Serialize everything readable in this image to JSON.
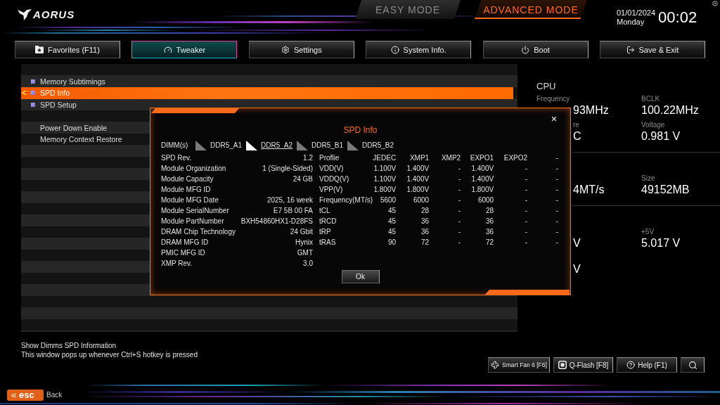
{
  "header": {
    "logo": "AORUS",
    "modes": [
      {
        "label": "EASY MODE",
        "selected": false
      },
      {
        "label": "ADVANCED MODE",
        "selected": true
      }
    ],
    "date": "01/01/2024",
    "day": "Monday",
    "time": "00:02"
  },
  "nav_tabs": [
    {
      "label": "Favorites (F11)",
      "selected": false
    },
    {
      "label": "Tweaker",
      "selected": true
    },
    {
      "label": "Settings",
      "selected": false
    },
    {
      "label": "System Info.",
      "selected": false
    },
    {
      "label": "Boot",
      "selected": false
    },
    {
      "label": "Save & Exit",
      "selected": false
    }
  ],
  "menu": {
    "groups": [
      {
        "items": [
          {
            "kind": "submenu",
            "label": "Memory Subtimings",
            "selected": false
          },
          {
            "kind": "submenu",
            "label": "SPD Info",
            "selected": true
          },
          {
            "kind": "submenu",
            "label": "SPD Setup",
            "selected": false
          }
        ]
      },
      {
        "items": [
          {
            "kind": "setting",
            "label": "Power Down Enable",
            "selected": false
          },
          {
            "kind": "setting",
            "label": "Memory Context Restore",
            "selected": false
          }
        ]
      }
    ]
  },
  "status_panel": {
    "title": "CPU",
    "groups": [
      {
        "rows": [
          {
            "cells": [
              {
                "label": "Frequency",
                "value": "93MHz"
              },
              {
                "label": "BCLK",
                "value": "100.22MHz"
              }
            ]
          },
          {
            "cells": [
              {
                "label": "re",
                "value": "C"
              },
              {
                "label": "Voltage",
                "value": "0.981 V"
              }
            ]
          }
        ]
      },
      {
        "rows": [
          {
            "cells": [
              {
                "value": "4MT/s"
              },
              {
                "label": "Size",
                "value": "49152MB"
              }
            ]
          }
        ]
      },
      {
        "rows": [
          {
            "cells": [
              {
                "value": "V"
              },
              {
                "label": "+5V",
                "value": "5.017 V"
              }
            ]
          },
          {
            "cells": [
              {
                "value": "V"
              }
            ]
          }
        ]
      }
    ]
  },
  "spd_dialog": {
    "title": "SPD Info",
    "dimm_label": "DIMM(s)",
    "dimms": [
      {
        "label": "DDR5_A1",
        "selected": false
      },
      {
        "label": "DDR5_A2",
        "selected": true
      },
      {
        "label": "DDR5_B1",
        "selected": false
      },
      {
        "label": "DDR5_B2",
        "selected": false
      }
    ],
    "module_info": [
      {
        "label": "SPD Rev.",
        "value": "1.2"
      },
      {
        "label": "Module Organization",
        "value": "1 (Single-Sided)"
      },
      {
        "label": "Module Capacity",
        "value": "24 GB"
      },
      {
        "label": "Module MFG ID"
      },
      {
        "label": "Module MFG Date",
        "value": "2025, 16 week"
      },
      {
        "label": "Module SerialNumber",
        "value": "E7 5B 00 FA"
      },
      {
        "label": "Module PartNumber",
        "value": "BXH54860HX1-D28FS"
      },
      {
        "label": "DRAM Chip Technology",
        "value": "24 Gbit"
      },
      {
        "label": "DRAM MFG ID",
        "value": "Hynix"
      },
      {
        "label": "PMIC MFG ID",
        "value": "GMT"
      },
      {
        "label": "XMP Rev.",
        "value": "3.0"
      }
    ],
    "profiles": {
      "columns": [
        "Proflie",
        "JEDEC",
        "XMP1",
        "XMP2",
        "EXPO1",
        "EXPO2",
        "-"
      ],
      "rows": [
        {
          "label": "VDD(V)",
          "values": [
            "1.100V",
            "1.400V",
            "-",
            "1.400V",
            "-",
            "-"
          ]
        },
        {
          "label": "VDDQ(V)",
          "values": [
            "1.100V",
            "1.400V",
            "-",
            "1.400V",
            "-",
            "-"
          ]
        },
        {
          "label": "VPP(V)",
          "values": [
            "1.800V",
            "1.800V",
            "-",
            "1.800V",
            "-",
            "-"
          ]
        },
        {
          "label": "Frequency(MT/s)",
          "values": [
            "5600",
            "6000",
            "-",
            "6000",
            "-",
            "-"
          ]
        },
        {
          "label": "tCL",
          "values": [
            "45",
            "28",
            "-",
            "28",
            "-",
            "-"
          ]
        },
        {
          "label": "tRCD",
          "values": [
            "45",
            "36",
            "-",
            "36",
            "-",
            "-"
          ]
        },
        {
          "label": "tRP",
          "values": [
            "45",
            "36",
            "-",
            "36",
            "-",
            "-"
          ]
        },
        {
          "label": "tRAS",
          "values": [
            "90",
            "72",
            "-",
            "72",
            "-",
            "-"
          ]
        }
      ]
    },
    "ok_button": "Ok"
  },
  "description": [
    "Show Dimms SPD Information",
    "This window pops up whenever Ctrl+S hotkey is pressed"
  ],
  "hotkeys": [
    "Smart Fan 6 [F6]",
    "Q-Flash [F8]",
    "Help (F1)"
  ],
  "back": {
    "key": "esc",
    "label": "Back"
  }
}
